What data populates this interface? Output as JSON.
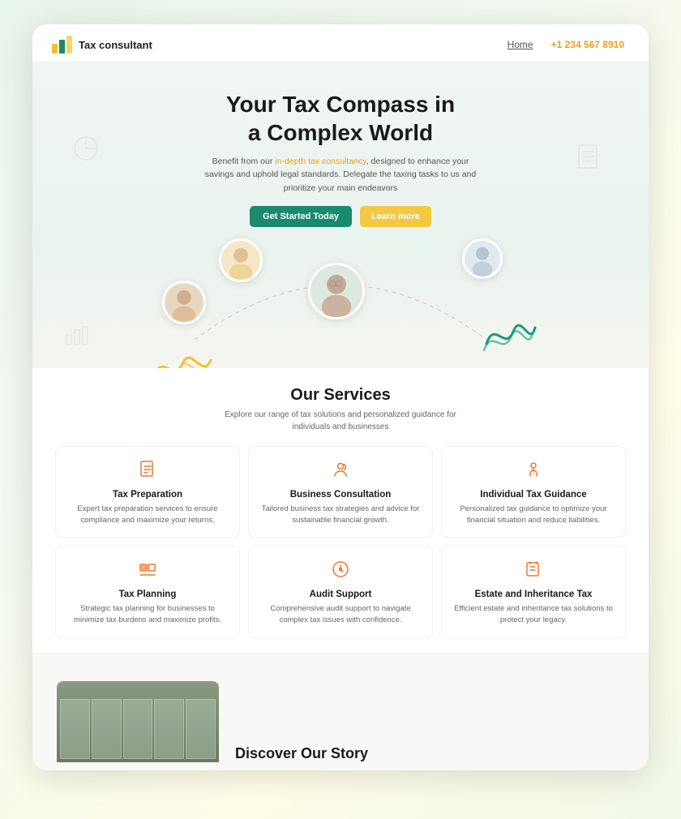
{
  "navbar": {
    "logo_text": "Tax consultant",
    "nav_home": "Home",
    "nav_phone": "+1 234 567 8910"
  },
  "hero": {
    "title_line1": "Your Tax Compass in",
    "title_line2": "a Complex World",
    "subtitle": "Benefit from our in-depth tax consultancy, designed to enhance your savings and uphold legal standards. Delegate the taxing tasks to us and prioritize your main endeavors",
    "btn_primary": "Get Started Today",
    "btn_secondary": "Learn more"
  },
  "services": {
    "title": "Our Services",
    "subtitle": "Explore our range of tax solutions and personalized guidance for individuals and businesses",
    "cards": [
      {
        "name": "Tax Preparation",
        "desc": "Expert tax preparation services to ensure compliance and maximize your returns.",
        "icon": "tax-preparation-icon"
      },
      {
        "name": "Business Consultation",
        "desc": "Tailored business tax strategies and advice for sustainable financial growth.",
        "icon": "business-consultation-icon"
      },
      {
        "name": "Individual Tax Guidance",
        "desc": "Personalized tax guidance to optimize your financial situation and reduce liabilities.",
        "icon": "individual-tax-icon"
      },
      {
        "name": "Tax Planning",
        "desc": "Strategic tax planning for businesses to minimize tax burdens and maximize profits.",
        "icon": "tax-planning-icon"
      },
      {
        "name": "Audit Support",
        "desc": "Comprehensive audit support to navigate complex tax issues with confidence.",
        "icon": "audit-support-icon"
      },
      {
        "name": "Estate and Inheritance Tax",
        "desc": "Efficient estate and inheritance tax solutions to protect your legacy.",
        "icon": "estate-tax-icon"
      }
    ]
  },
  "discover": {
    "title": "Discover Our Story"
  }
}
